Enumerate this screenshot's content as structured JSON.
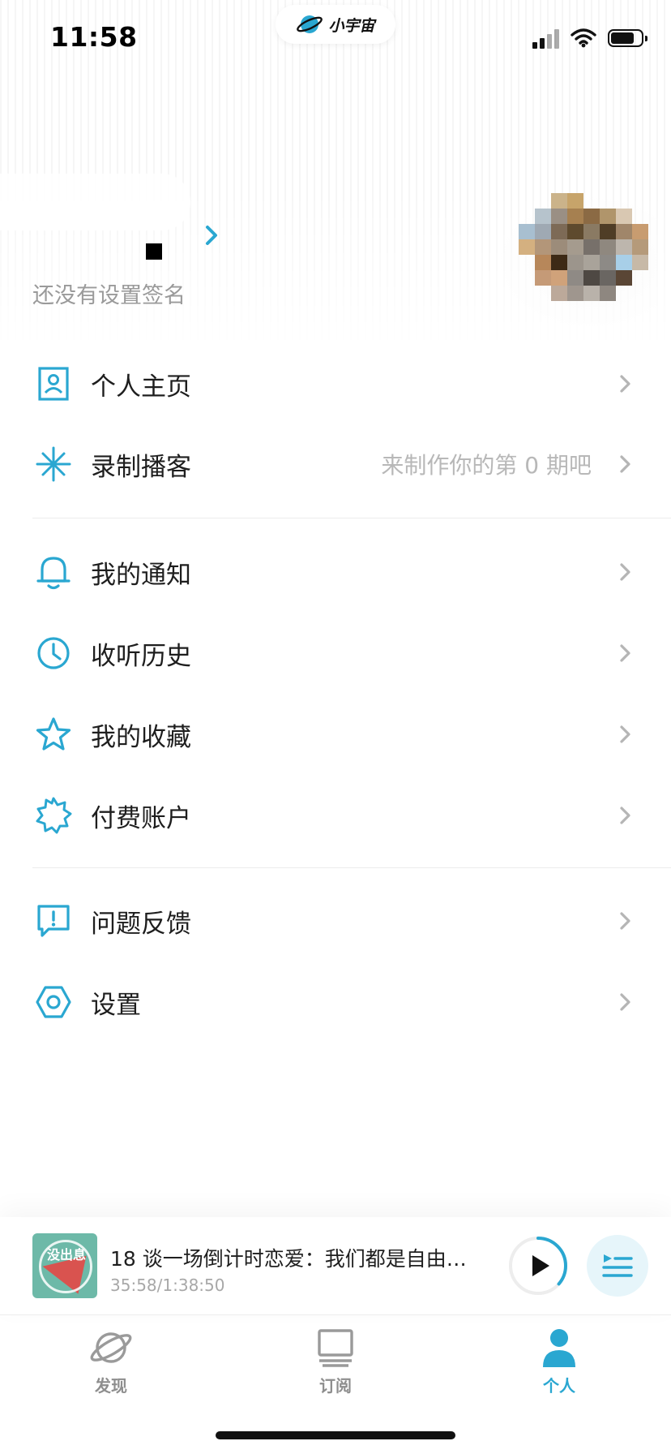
{
  "status_bar": {
    "time": "11:58",
    "app_name": "小宇宙"
  },
  "profile": {
    "signature": "还没有设置签名"
  },
  "menu": {
    "group1": [
      {
        "id": "homepage",
        "label": "个人主页",
        "hint": ""
      },
      {
        "id": "record",
        "label": "录制播客",
        "hint": "来制作你的第 0 期吧"
      }
    ],
    "group2": [
      {
        "id": "notifications",
        "label": "我的通知"
      },
      {
        "id": "history",
        "label": "收听历史"
      },
      {
        "id": "favorites",
        "label": "我的收藏"
      },
      {
        "id": "paid",
        "label": "付费账户"
      }
    ],
    "group3": [
      {
        "id": "feedback",
        "label": "问题反馈"
      },
      {
        "id": "settings",
        "label": "设置"
      }
    ]
  },
  "player": {
    "episode_title": "18 谈一场倒计时恋爱：我们都是自由…",
    "progress_text": "35:58/1:38:50",
    "progress_fraction": 0.364,
    "cover_text": "没出息"
  },
  "tabbar": {
    "tabs": [
      {
        "id": "discover",
        "label": "发现",
        "active": false
      },
      {
        "id": "subscribe",
        "label": "订阅",
        "active": false
      },
      {
        "id": "me",
        "label": "个人",
        "active": true
      }
    ]
  },
  "colors": {
    "accent": "#2aa7d1",
    "text": "#1e1e1e",
    "muted": "#9a9a9a"
  }
}
